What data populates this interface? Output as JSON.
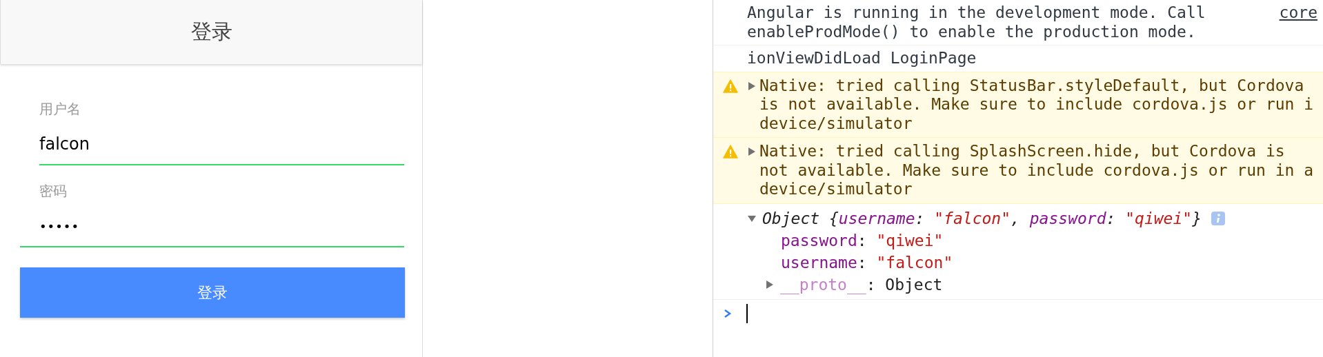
{
  "app": {
    "title": "登录",
    "fields": [
      {
        "kind": "text",
        "label": "用户名",
        "value": "falcon"
      },
      {
        "kind": "password",
        "label": "密码",
        "value": "•••••"
      }
    ],
    "button": "登录"
  },
  "console": {
    "messages": [
      {
        "kind": "log",
        "text": "Angular is running in the development mode. Call\nenableProdMode() to enable the production mode.",
        "link": "core"
      },
      {
        "kind": "log",
        "text": "ionViewDidLoad LoginPage"
      },
      {
        "kind": "warning",
        "expanded": false,
        "text": "Native: tried calling StatusBar.styleDefault, but Cordova\nis not available. Make sure to include cordova.js or run i\ndevice/simulator"
      },
      {
        "kind": "warning",
        "expanded": false,
        "text": "Native: tried calling SplashScreen.hide, but Cordova is\nnot available. Make sure to include cordova.js or run in a\ndevice/simulator"
      },
      {
        "kind": "object",
        "expanded": true,
        "preview": [
          {
            "kind": "plain",
            "text": "Object {"
          },
          {
            "kind": "key",
            "text": "username"
          },
          {
            "kind": "plain",
            "text": ": "
          },
          {
            "kind": "string",
            "text": "\"falcon\""
          },
          {
            "kind": "plain",
            "text": ", "
          },
          {
            "kind": "key",
            "text": "password"
          },
          {
            "kind": "plain",
            "text": ": "
          },
          {
            "kind": "string",
            "text": "\"qiwei\""
          },
          {
            "kind": "plain",
            "text": "}"
          }
        ],
        "properties": [
          {
            "segments": [
              {
                "kind": "key",
                "text": "password"
              },
              {
                "kind": "plain",
                "text": ": "
              },
              {
                "kind": "string",
                "text": "\"qiwei\""
              }
            ]
          },
          {
            "segments": [
              {
                "kind": "key",
                "text": "username"
              },
              {
                "kind": "plain",
                "text": ": "
              },
              {
                "kind": "string",
                "text": "\"falcon\""
              }
            ]
          }
        ],
        "prototype": {
          "expanded": false,
          "segments": [
            {
              "kind": "proto",
              "text": "__proto__"
            },
            {
              "kind": "plain",
              "text": ": Object"
            }
          ]
        }
      }
    ]
  }
}
